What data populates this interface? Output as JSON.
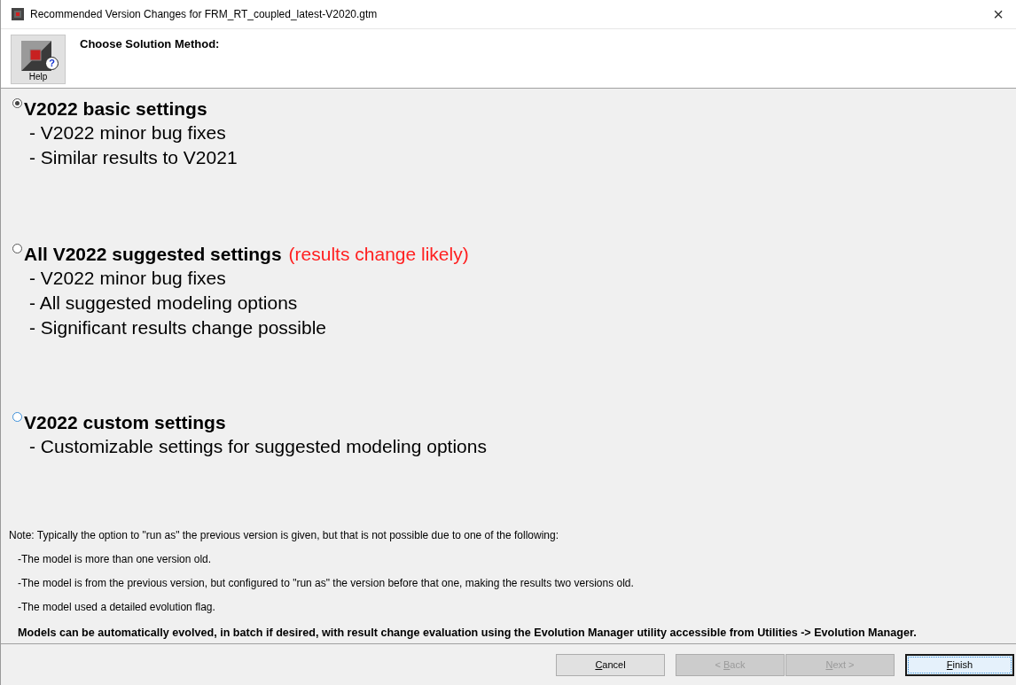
{
  "window": {
    "title": "Recommended Version Changes for FRM_RT_coupled_latest-V2020.gtm",
    "close": "×"
  },
  "header": {
    "help_button": "Help",
    "help_badge": "?",
    "heading": "Choose Solution Method:"
  },
  "options": [
    {
      "title": "V2022 basic settings",
      "selected": true,
      "highlighted": false,
      "bullets": [
        "- V2022 minor bug fixes",
        "- Similar results to V2021"
      ]
    },
    {
      "title": "All V2022 suggested settings",
      "warning": "(results change likely)",
      "selected": false,
      "highlighted": false,
      "bullets": [
        "- V2022 minor bug fixes",
        "- All suggested modeling options",
        "- Significant results change possible"
      ]
    },
    {
      "title": "V2022 custom settings",
      "selected": false,
      "highlighted": true,
      "bullets": [
        "- Customizable settings for suggested modeling options"
      ]
    }
  ],
  "note": {
    "intro": "Note: Typically the option to \"run as\" the previous version is given, but that is not possible due to one of the following:",
    "reasons": [
      "-The model is more than one version old.",
      "-The model is from the previous version, but configured to \"run as\" the version before that one, making the results two versions old.",
      "-The model used a detailed evolution flag."
    ],
    "tip": "Models can be automatically evolved, in batch if desired, with result change evaluation using the Evolution Manager utility accessible from Utilities -> Evolution Manager."
  },
  "buttons": [
    {
      "key": "C",
      "after": "ancel",
      "disabled": false,
      "default": false
    },
    {
      "before": "< ",
      "key": "B",
      "after": "ack",
      "disabled": true,
      "default": false
    },
    {
      "key": "N",
      "after": "ext >",
      "disabled": true,
      "default": false
    },
    {
      "key": "F",
      "after": "inish",
      "disabled": false,
      "default": true
    }
  ]
}
